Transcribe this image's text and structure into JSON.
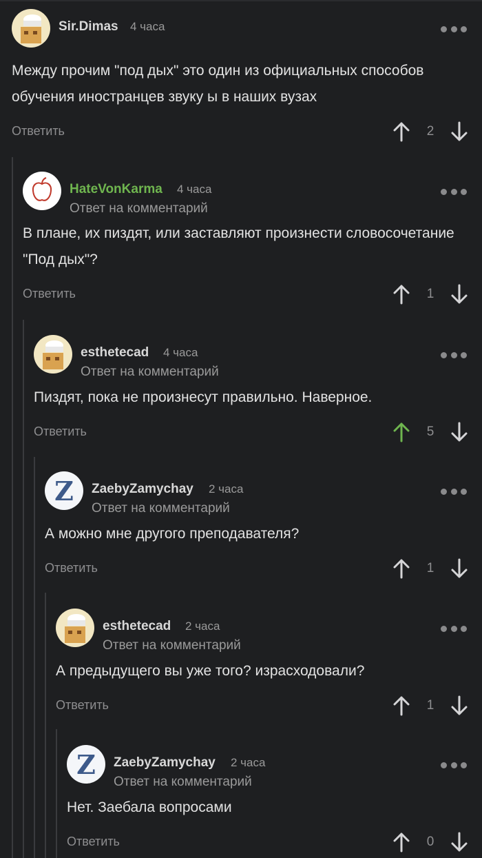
{
  "reply_label": "Ответить",
  "sub_label": "Ответ на комментарий",
  "accent_upvote": "#6fb54f",
  "accent_username": "#6fb54f",
  "comments": [
    {
      "author": "Sir.Dimas",
      "time": "4 часа",
      "text": "Между прочим \"под дых\" это один из официальных способов обучения иностранцев звуку ы в наших вузах",
      "votes": "2",
      "avatar_icon": "cook-avatar-icon",
      "upvoted": false
    },
    {
      "author": "HateVonKarma",
      "time": "4 часа",
      "text": "В плане, их пиздят, или заставляют произнести словосочетание \"Под дых\"?",
      "votes": "1",
      "avatar_icon": "apple-logo-avatar-icon",
      "upvoted": false
    },
    {
      "author": "esthetecad",
      "time": "4 часа",
      "text": "Пиздят, пока не произнесут правильно. Наверное.",
      "votes": "5",
      "avatar_icon": "cook-avatar-icon",
      "upvoted": true
    },
    {
      "author": "ZaebyZamychay",
      "time": "2 часа",
      "text": "А можно мне другого преподавателя?",
      "votes": "1",
      "avatar_icon": "letter-z-avatar-icon",
      "upvoted": false
    },
    {
      "author": "esthetecad",
      "time": "2 часа",
      "text": "А предыдущего вы уже того? израсходовали?",
      "votes": "1",
      "avatar_icon": "cook-avatar-icon",
      "upvoted": false
    },
    {
      "author": "ZaebyZamychay",
      "time": "2 часа",
      "text": "Нет. Заебала вопросами",
      "votes": "0",
      "avatar_icon": "letter-z-avatar-icon",
      "upvoted": false
    }
  ]
}
